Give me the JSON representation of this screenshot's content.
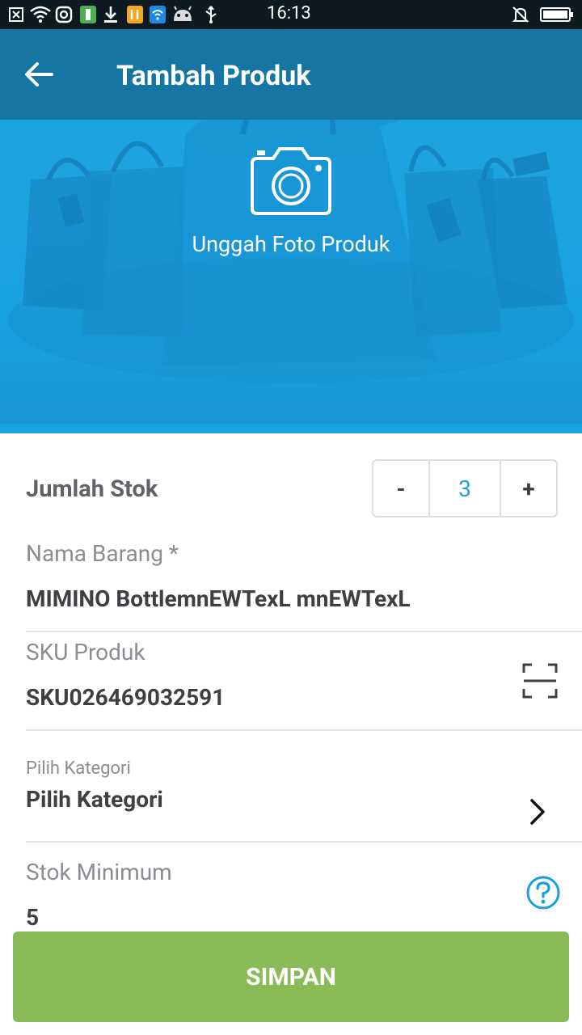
{
  "status_bar": {
    "time": "16:13",
    "ghost_text": "",
    "icons": [
      "notification-icon",
      "wifi-icon",
      "instagram-icon",
      "battery-app-icon",
      "download-icon",
      "app-icon",
      "wifi-app-icon",
      "android-icon",
      "usb-icon",
      "silent-icon",
      "battery-icon"
    ]
  },
  "header": {
    "title": "Tambah Produk",
    "back_icon": "arrow-left-icon"
  },
  "hero": {
    "upload_label": "Unggah Foto Produk",
    "camera_icon": "camera-icon"
  },
  "form": {
    "stock": {
      "label": "Jumlah Stok",
      "minus": "-",
      "value": "3",
      "plus": "+"
    },
    "name": {
      "label": "Nama Barang *",
      "value": "MIMINO BottlemnEWTexL  mnEWTexL"
    },
    "sku": {
      "label": "SKU Produk",
      "value": "SKU026469032591",
      "scan_icon": "scan-icon"
    },
    "category": {
      "small_label": "Pilih Kategori",
      "value": "Pilih Kategori",
      "chevron_icon": "chevron-right-icon"
    },
    "min_stock": {
      "label": "Stok Minimum",
      "value": "5",
      "help_icon": "help-icon"
    }
  },
  "actions": {
    "save_label": "SIMPAN"
  },
  "colors": {
    "app_bar": "#1576a4",
    "hero": "#1fa4df",
    "accent": "#1a9fe0",
    "save_button": "#8bbb57"
  }
}
